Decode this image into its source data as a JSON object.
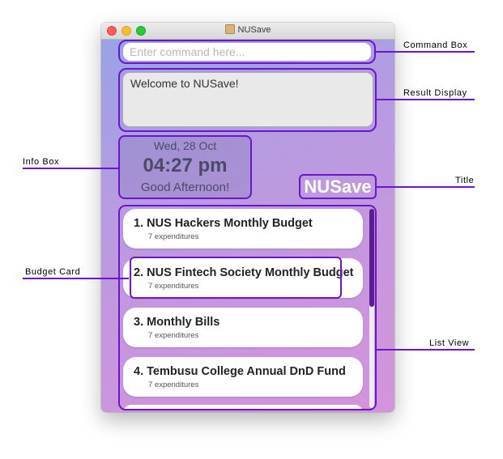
{
  "window": {
    "title": "NUSave"
  },
  "command_box": {
    "placeholder": "Enter command here..."
  },
  "result_display": {
    "text": "Welcome to NUSave!"
  },
  "info_box": {
    "date": "Wed, 28 Oct",
    "time": "04:27 pm",
    "greeting": "Good Afternoon!"
  },
  "title": {
    "text": "NUSave"
  },
  "list": {
    "items": [
      {
        "label": "1.  NUS Hackers Monthly Budget",
        "sub": "7 expenditures"
      },
      {
        "label": "2.  NUS Fintech Society Monthly Budget",
        "sub": "7 expenditures"
      },
      {
        "label": "3.  Monthly Bills",
        "sub": "7 expenditures"
      },
      {
        "label": "4.  Tembusu College Annual DnD Fund",
        "sub": "7 expenditures"
      }
    ]
  },
  "annotations": {
    "command_box": "Command Box",
    "result_display": "Result Display",
    "info_box": "Info Box",
    "title": "Title",
    "budget_card": "Budget Card",
    "list_view": "List View"
  },
  "colors": {
    "accent": "#6b16c9",
    "scrollbar": "#5a1d92"
  }
}
